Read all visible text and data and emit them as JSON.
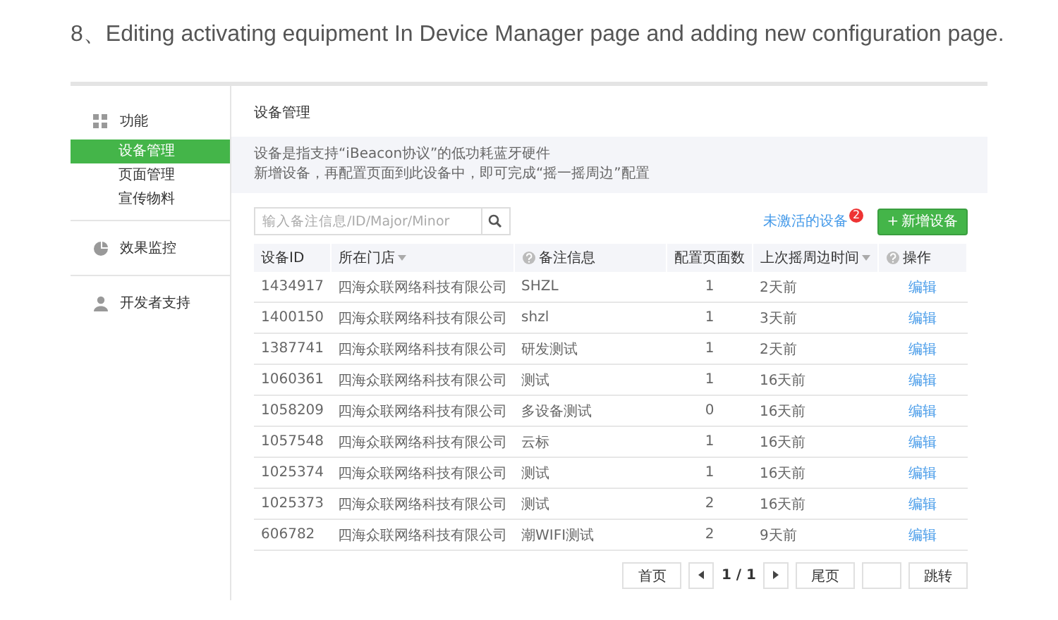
{
  "caption": "8、Editing activating equipment In Device Manager page and adding new configuration page.",
  "sidebar": {
    "groups": [
      {
        "label": "功能",
        "items": [
          {
            "label": "设备管理",
            "selected": true
          },
          {
            "label": "页面管理",
            "selected": false
          },
          {
            "label": "宣传物料",
            "selected": false
          }
        ]
      },
      {
        "label": "效果监控"
      },
      {
        "label": "开发者支持"
      }
    ]
  },
  "page_title": "设备管理",
  "notice": [
    "设备是指支持“iBeacon协议”的低功耗蓝牙硬件",
    "新增设备，再配置页面到此设备中，即可完成“摇一摇周边”配置"
  ],
  "search": {
    "placeholder": "输入备注信息/ID/Major/Minor"
  },
  "inactive_link": {
    "label": "未激活的设备",
    "badge": "2"
  },
  "add_button": {
    "icon": "+",
    "label": "新增设备"
  },
  "table": {
    "columns": [
      {
        "label": "设备ID",
        "help": false,
        "sortable": false
      },
      {
        "label": "所在门店",
        "help": false,
        "sortable": true
      },
      {
        "label": "备注信息",
        "help": true,
        "sortable": false
      },
      {
        "label": "配置页面数",
        "help": false,
        "sortable": false
      },
      {
        "label": "上次摇周边时间",
        "help": false,
        "sortable": true
      },
      {
        "label": "操作",
        "help": true,
        "sortable": false
      }
    ],
    "rows": [
      {
        "id": "1434917",
        "store": "四海众联网络科技有限公司",
        "note": "SHZL",
        "pages": "1",
        "last": "2天前",
        "action": "编辑"
      },
      {
        "id": "1400150",
        "store": "四海众联网络科技有限公司",
        "note": "shzl",
        "pages": "1",
        "last": "3天前",
        "action": "编辑"
      },
      {
        "id": "1387741",
        "store": "四海众联网络科技有限公司",
        "note": "研发测试",
        "pages": "1",
        "last": "2天前",
        "action": "编辑"
      },
      {
        "id": "1060361",
        "store": "四海众联网络科技有限公司",
        "note": "测试",
        "pages": "1",
        "last": "16天前",
        "action": "编辑"
      },
      {
        "id": "1058209",
        "store": "四海众联网络科技有限公司",
        "note": "多设备测试",
        "pages": "0",
        "last": "16天前",
        "action": "编辑"
      },
      {
        "id": "1057548",
        "store": "四海众联网络科技有限公司",
        "note": "云标",
        "pages": "1",
        "last": "16天前",
        "action": "编辑"
      },
      {
        "id": "1025374",
        "store": "四海众联网络科技有限公司",
        "note": "测试",
        "pages": "1",
        "last": "16天前",
        "action": "编辑"
      },
      {
        "id": "1025373",
        "store": "四海众联网络科技有限公司",
        "note": "测试",
        "pages": "2",
        "last": "16天前",
        "action": "编辑"
      },
      {
        "id": "606782",
        "store": "四海众联网络科技有限公司",
        "note": "潮WIFI测试",
        "pages": "2",
        "last": "9天前",
        "action": "编辑"
      }
    ]
  },
  "pagination": {
    "first": "首页",
    "page": "1 / 1",
    "last": "尾页",
    "jump": "跳转"
  }
}
